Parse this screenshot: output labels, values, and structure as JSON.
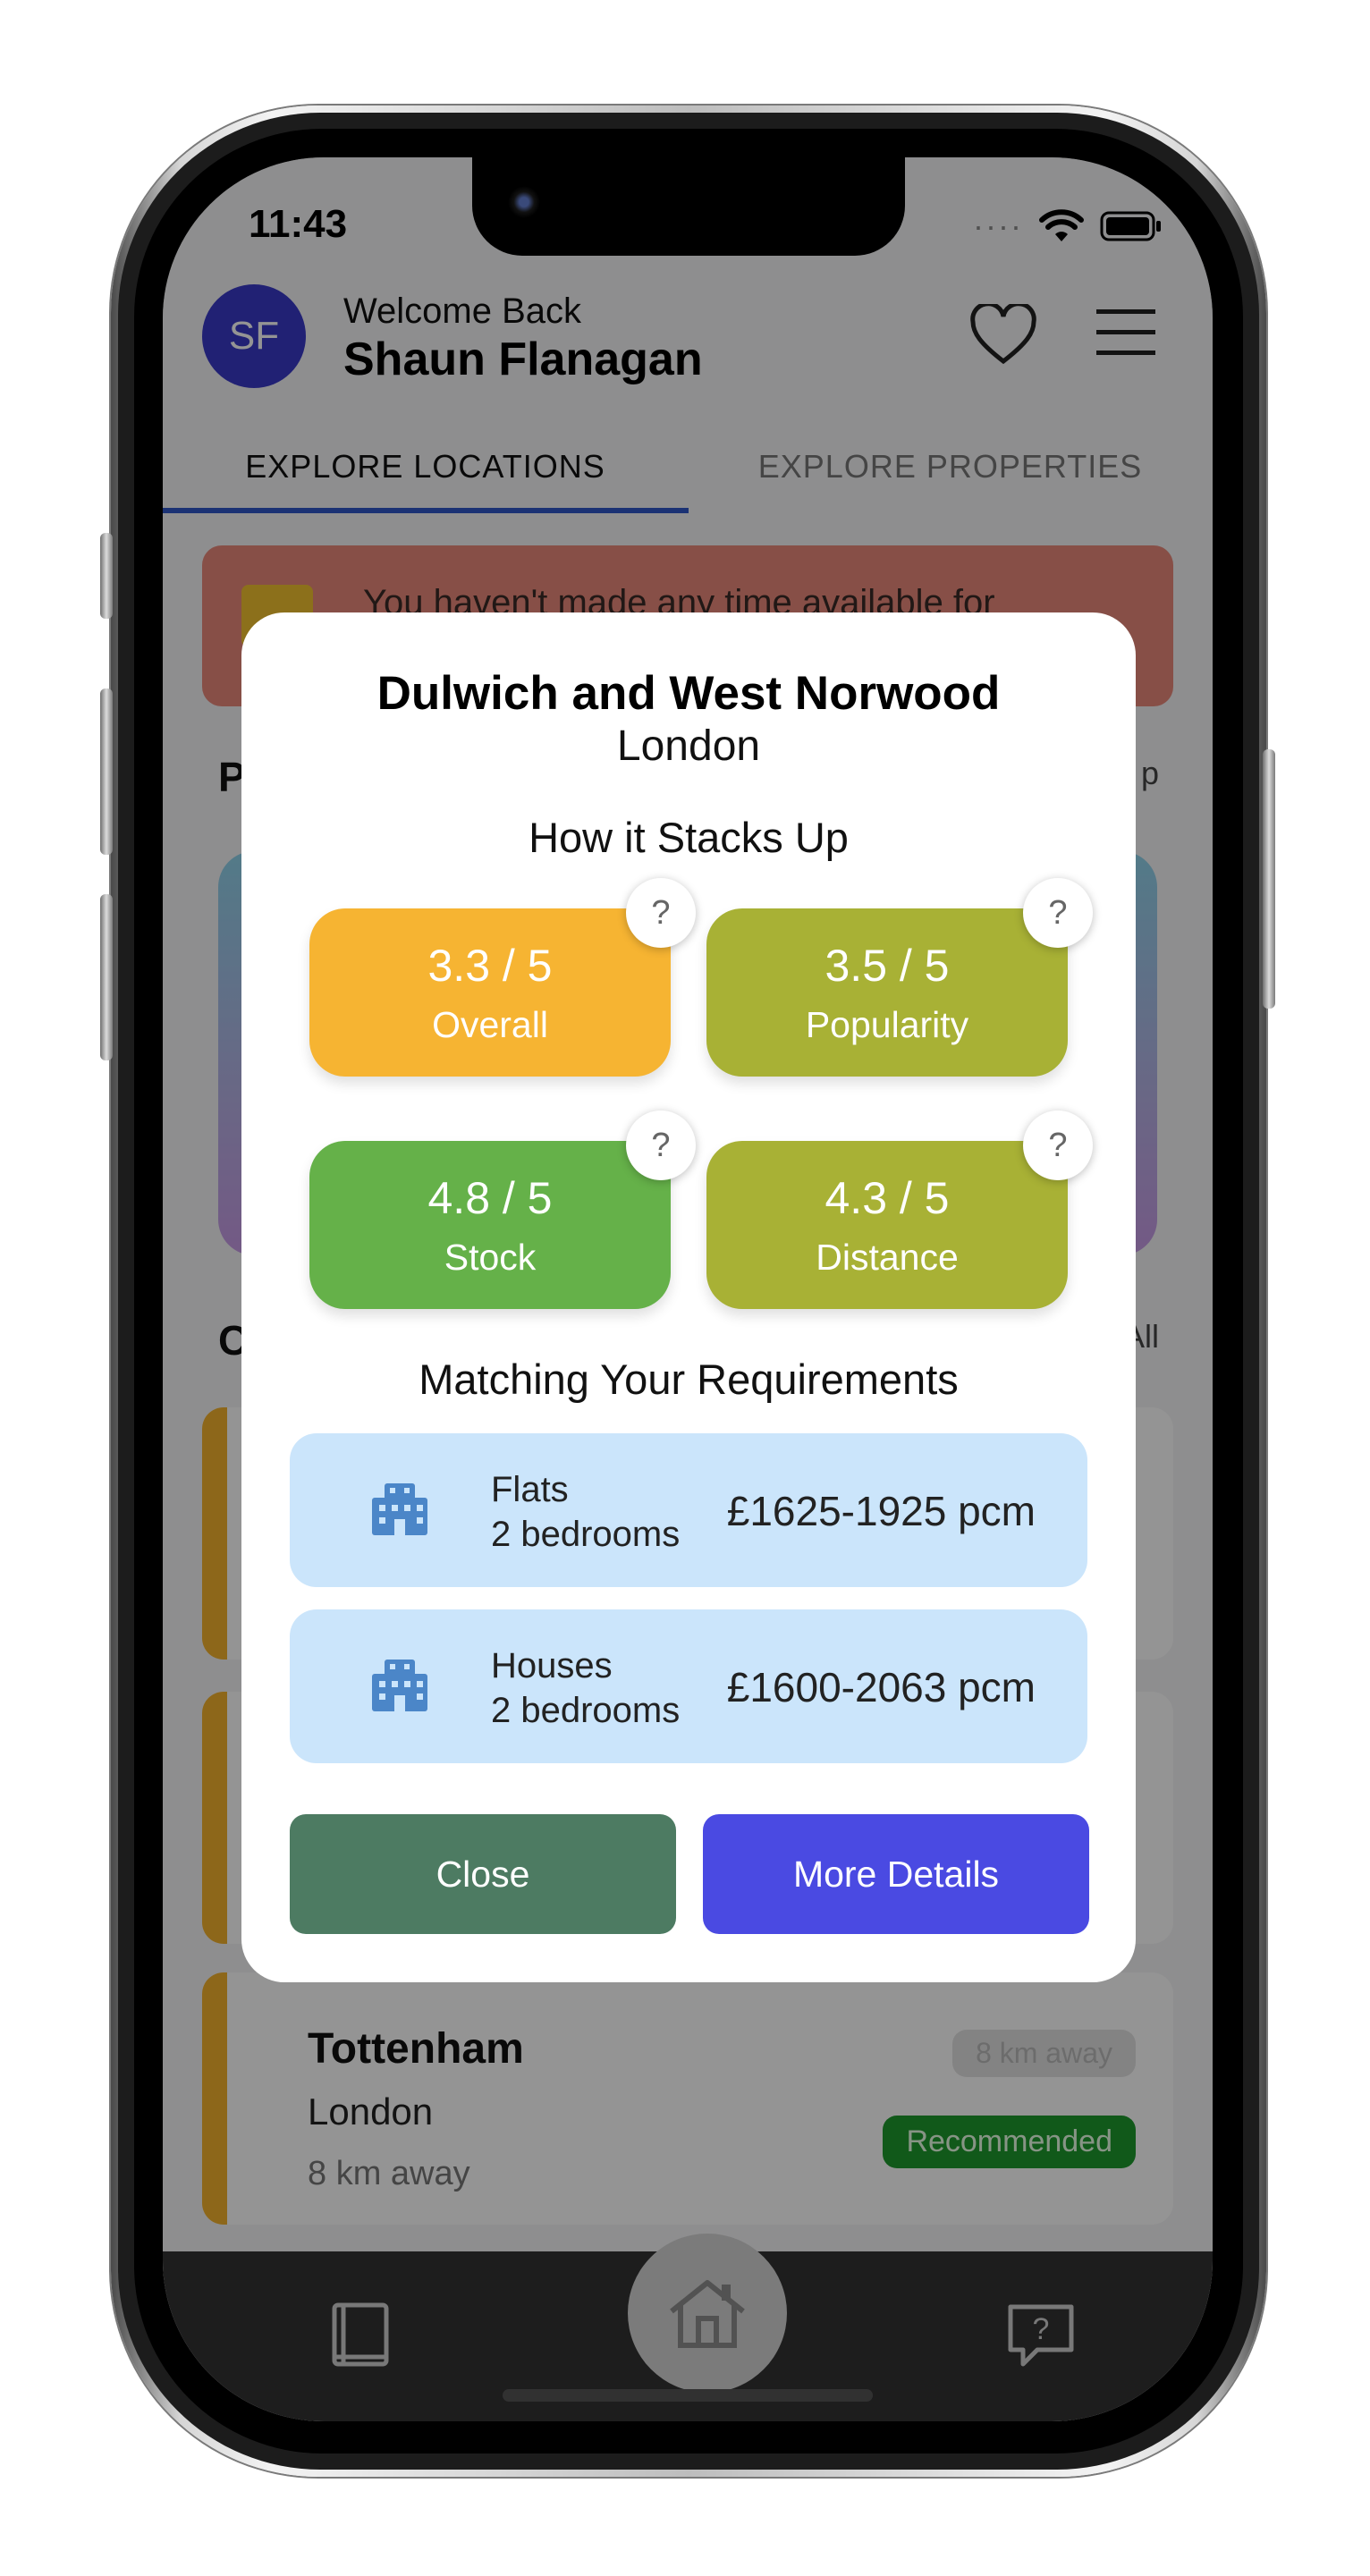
{
  "status_bar": {
    "time": "11:43",
    "signal": "····"
  },
  "header": {
    "avatar_initials": "SF",
    "welcome": "Welcome Back",
    "name": "Shaun Flanagan"
  },
  "tabs": [
    {
      "label": "EXPLORE LOCATIONS",
      "active": true
    },
    {
      "label": "EXPLORE PROPERTIES",
      "active": false
    }
  ],
  "banner": {
    "text": "You haven't made any time available for"
  },
  "background": {
    "section1_fragment": "P",
    "section1_link_fragment": "p",
    "section2_fragment": "C",
    "section2_link_fragment": "All",
    "cards": [
      {
        "name": "Tottenham",
        "city": "London",
        "distance": "8 km away",
        "distance_badge": "8 km away",
        "tag": "Recommended"
      }
    ]
  },
  "modal": {
    "title": "Dulwich and West Norwood",
    "subtitle": "London",
    "scores_heading": "How it Stacks Up",
    "scores": [
      {
        "value": "3.3 / 5",
        "label": "Overall",
        "color": "#f6b432"
      },
      {
        "value": "3.5 / 5",
        "label": "Popularity",
        "color": "#a8b135"
      },
      {
        "value": "4.8 / 5",
        "label": "Stock",
        "color": "#65b149"
      },
      {
        "value": "4.3 / 5",
        "label": "Distance",
        "color": "#a8b135"
      }
    ],
    "help_label": "?",
    "requirements_heading": "Matching Your Requirements",
    "requirements": [
      {
        "type": "Flats",
        "bedrooms": "2 bedrooms",
        "price": "£1625-1925 pcm"
      },
      {
        "type": "Houses",
        "bedrooms": "2 bedrooms",
        "price": "£1600-2063 pcm"
      }
    ],
    "close_label": "Close",
    "more_label": "More Details"
  },
  "colors": {
    "accent_tab": "#2f56c9",
    "close_button": "#4d7b62",
    "more_button": "#4a4ae2",
    "requirement_bg": "#cbe5fb"
  }
}
